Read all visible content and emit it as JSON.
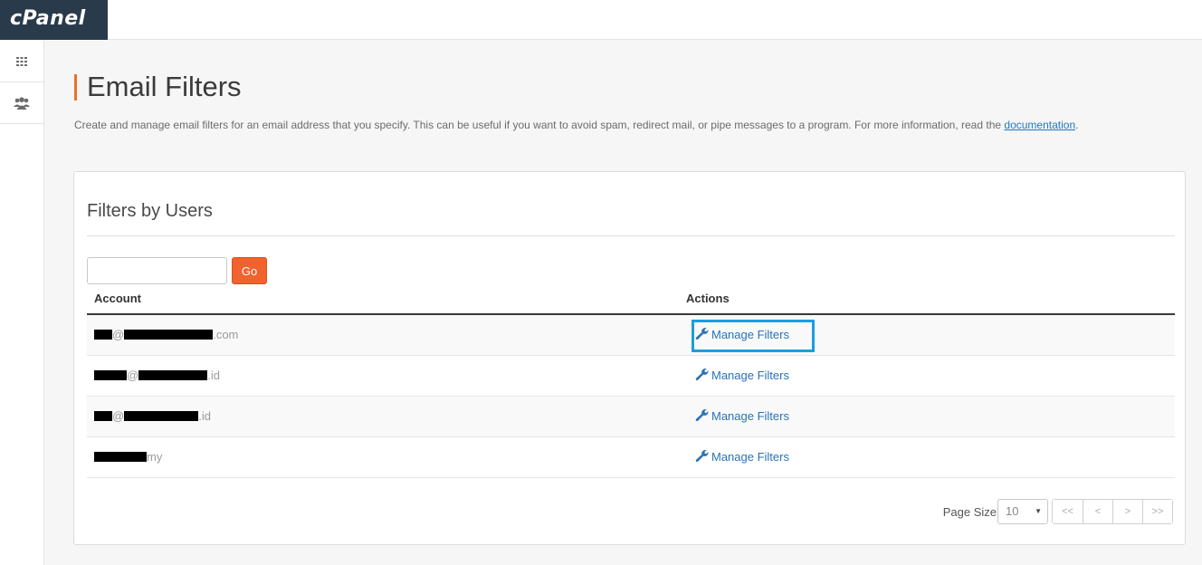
{
  "app": {
    "logo_text": "cPanel"
  },
  "sidebar": {
    "items": [
      {
        "name": "apps-grid",
        "icon": "grid-icon"
      },
      {
        "name": "users",
        "icon": "users-icon"
      }
    ]
  },
  "page": {
    "title": "Email Filters",
    "description_text": "Create and manage email filters for an email address that you specify. This can be useful if you want to avoid spam, redirect mail, or pipe messages to a program. For more information, read the ",
    "documentation_link": "documentation",
    "description_end": "."
  },
  "panel": {
    "title": "Filters by Users",
    "search": {
      "value": "",
      "placeholder": ""
    },
    "go_label": "Go",
    "columns": {
      "account": "Account",
      "actions": "Actions"
    },
    "rows": [
      {
        "local_visible": "",
        "at": "@",
        "domain_visible": "",
        "tld": ".com",
        "action_label": "Manage Filters"
      },
      {
        "local_visible": "",
        "at": "@",
        "domain_visible": "",
        "tld": ".id",
        "action_label": "Manage Filters"
      },
      {
        "local_visible": "",
        "at": "@",
        "domain_visible": "",
        "tld": ".id",
        "action_label": "Manage Filters"
      },
      {
        "local_visible": "",
        "at": "",
        "domain_visible": "",
        "tld": "my",
        "action_label": "Manage Filters"
      }
    ],
    "pager": {
      "page_size_label": "Page Size",
      "page_size_value": "10",
      "first": "<<",
      "prev": "<",
      "next": ">",
      "last": ">>"
    }
  },
  "colors": {
    "accent": "#ea6e2e",
    "go_button": "#f0622e",
    "link": "#2a73b8",
    "highlight": "#1a9ee0"
  }
}
